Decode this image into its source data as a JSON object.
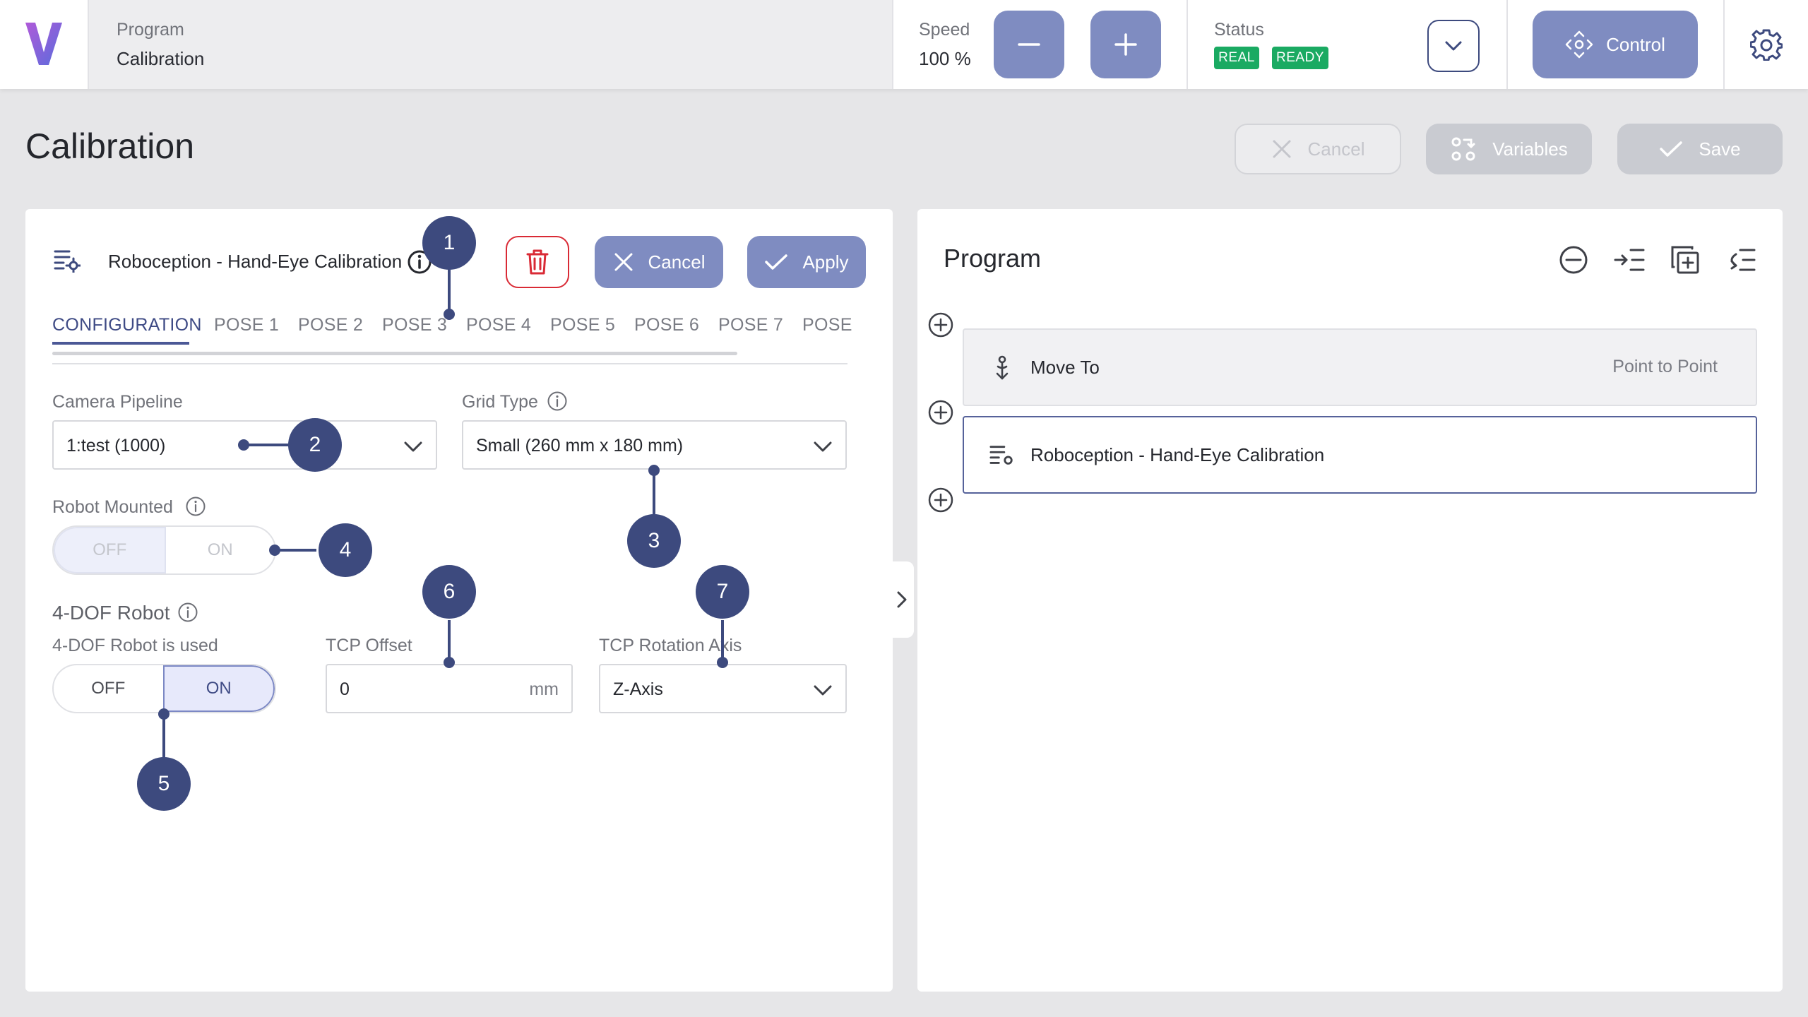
{
  "topbar": {
    "program_label": "Program",
    "program_value": "Calibration",
    "speed_label": "Speed",
    "speed_value": "100 %",
    "status_label": "Status",
    "status_badges": [
      "REAL",
      "READY"
    ],
    "control_label": "Control",
    "icons": [
      "v-logo-icon",
      "minus-icon",
      "plus-icon",
      "chevron-down-icon",
      "move-arrows-icon",
      "gear-icon"
    ]
  },
  "page": {
    "title": "Calibration",
    "cancel_label": "Cancel",
    "variables_label": "Variables",
    "save_label": "Save"
  },
  "node": {
    "title": "Roboception - Hand-Eye Calibration",
    "cancel_label": "Cancel",
    "apply_label": "Apply",
    "tabs": [
      "CONFIGURATION",
      "POSE 1",
      "POSE 2",
      "POSE 3",
      "POSE 4",
      "POSE 5",
      "POSE 6",
      "POSE 7",
      "POSE"
    ],
    "active_tab": "CONFIGURATION"
  },
  "config": {
    "camera_pipeline_label": "Camera Pipeline",
    "camera_pipeline_value": "1:test (1000)",
    "grid_type_label": "Grid Type",
    "grid_type_value": "Small (260 mm x 180 mm)",
    "robot_mounted_label": "Robot Mounted",
    "robot_mounted_off": "OFF",
    "robot_mounted_on": "ON",
    "dof_section": "4-DOF Robot",
    "dof_used_label": "4-DOF Robot is used",
    "dof_off": "OFF",
    "dof_on": "ON",
    "tcp_offset_label": "TCP Offset",
    "tcp_offset_value": "0",
    "tcp_offset_unit": "mm",
    "tcp_rotation_label": "TCP Rotation Axis",
    "tcp_rotation_value": "Z-Axis"
  },
  "callouts": [
    "1",
    "2",
    "3",
    "4",
    "5",
    "6",
    "7"
  ],
  "program_panel": {
    "title": "Program",
    "items": [
      {
        "label": "Move To",
        "type": "Point to Point"
      },
      {
        "label": "Roboception - Hand-Eye Calibration",
        "type": ""
      }
    ]
  },
  "colors": {
    "accent": "#7f8cc1",
    "accent_dark": "#3d4a7e",
    "status_green": "#1aaa62",
    "delete_red": "#d92a35"
  }
}
